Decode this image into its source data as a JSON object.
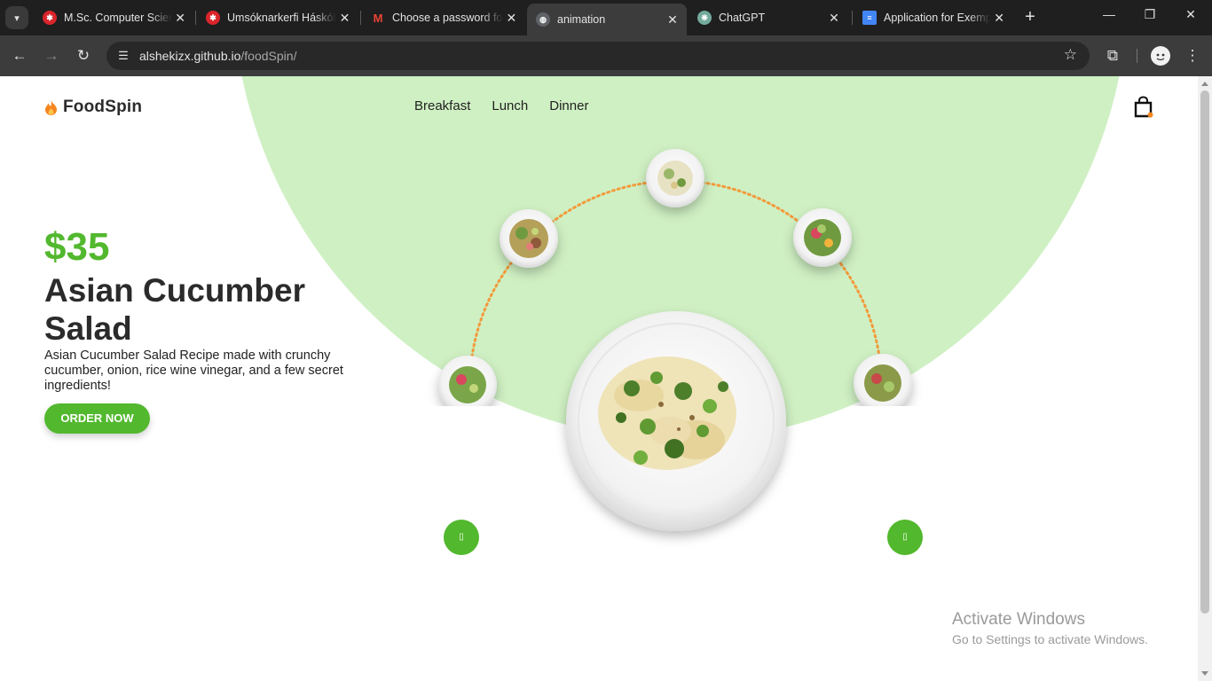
{
  "browser": {
    "tabs": [
      {
        "title": "M.Sc. Computer Science",
        "favicon": "university-icon",
        "favicon_color": "#d9252b"
      },
      {
        "title": "Umsóknarkerfi Háskóla",
        "favicon": "university-icon",
        "favicon_color": "#d9252b"
      },
      {
        "title": "Choose a password for",
        "favicon": "gmail-icon",
        "favicon_color": "#ea4335"
      },
      {
        "title": "animation",
        "favicon": "globe-icon",
        "favicon_color": "#5f6368",
        "active": true
      },
      {
        "title": "ChatGPT",
        "favicon": "chatgpt-icon",
        "favicon_color": "#74aa9c"
      },
      {
        "title": "Application for Exemp",
        "favicon": "docs-icon",
        "favicon_color": "#4285f4"
      }
    ],
    "url_host": "alshekizx.github.io",
    "url_path": "/foodSpin/"
  },
  "page": {
    "brand": "FoodSpin",
    "nav": [
      "Breakfast",
      "Lunch",
      "Dinner"
    ],
    "price": "$35",
    "title": "Asian Cucumber Salad",
    "description": "Asian Cucumber Salad Recipe made with crunchy cucumber, onion, rice wine vinegar, and a few secret ingredients!",
    "cta": "ORDER NOW",
    "prev_glyph": "▯",
    "next_glyph": "▯",
    "accent_color": "#52b82e",
    "bg_color": "#cff0c3",
    "orbit_color": "#f39a3a"
  },
  "os_overlay": {
    "line1": "Activate Windows",
    "line2": "Go to Settings to activate Windows."
  }
}
